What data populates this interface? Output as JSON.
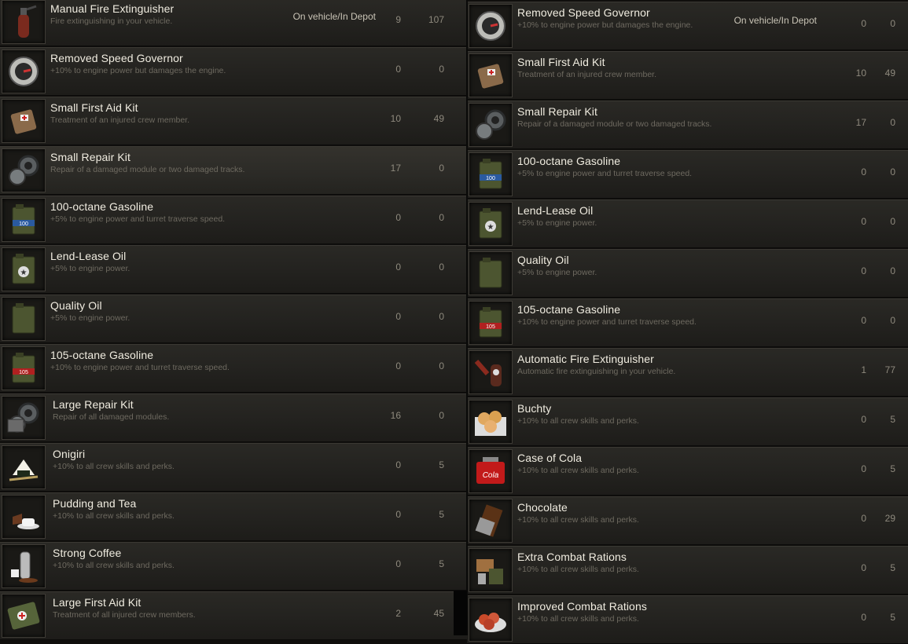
{
  "status_label": "On vehicle/In Depot",
  "left_items": [
    {
      "name": "Manual Fire Extinguisher",
      "desc": "Fire extinguishing in your vehicle.",
      "v1": "9",
      "v2": "107",
      "icon": "fire-extinguisher-icon",
      "status": true
    },
    {
      "name": "Removed Speed Governor",
      "desc": "+10% to engine power but damages the engine.",
      "v1": "0",
      "v2": "0",
      "icon": "speed-governor-icon"
    },
    {
      "name": "Small First Aid Kit",
      "desc": "Treatment of an injured crew member.",
      "v1": "10",
      "v2": "49",
      "icon": "first-aid-kit-icon"
    },
    {
      "name": "Small Repair Kit",
      "desc": "Repair of a damaged module or two damaged tracks.",
      "v1": "17",
      "v2": "0",
      "icon": "repair-kit-icon"
    },
    {
      "name": "100-octane Gasoline",
      "desc": "+5% to engine power and turret traverse speed.",
      "v1": "0",
      "v2": "0",
      "icon": "gasoline-100-icon"
    },
    {
      "name": "Lend-Lease Oil",
      "desc": "+5% to engine power.",
      "v1": "0",
      "v2": "0",
      "icon": "lend-lease-oil-icon"
    },
    {
      "name": "Quality Oil",
      "desc": "+5% to engine power.",
      "v1": "0",
      "v2": "0",
      "icon": "quality-oil-icon"
    },
    {
      "name": "105-octane Gasoline",
      "desc": "+10% to engine power and turret traverse speed.",
      "v1": "0",
      "v2": "0",
      "icon": "gasoline-105-icon"
    },
    {
      "name": "Large Repair Kit",
      "desc": "Repair of all damaged modules.",
      "v1": "16",
      "v2": "0",
      "icon": "large-repair-kit-icon"
    },
    {
      "name": "Onigiri",
      "desc": "+10% to all crew skills and perks.",
      "v1": "0",
      "v2": "5",
      "icon": "onigiri-icon"
    },
    {
      "name": "Pudding and Tea",
      "desc": "+10% to all crew skills and perks.",
      "v1": "0",
      "v2": "5",
      "icon": "pudding-tea-icon"
    },
    {
      "name": "Strong Coffee",
      "desc": "+10% to all crew skills and perks.",
      "v1": "0",
      "v2": "5",
      "icon": "coffee-icon"
    },
    {
      "name": "Large First Aid Kit",
      "desc": "Treatment of all injured crew members.",
      "v1": "2",
      "v2": "45",
      "icon": "large-first-aid-kit-icon"
    }
  ],
  "right_items": [
    {
      "name": "Removed Speed Governor",
      "desc": "+10% to engine power but damages the engine.",
      "v1": "0",
      "v2": "0",
      "icon": "speed-governor-icon",
      "status": true
    },
    {
      "name": "Small First Aid Kit",
      "desc": "Treatment of an injured crew member.",
      "v1": "10",
      "v2": "49",
      "icon": "first-aid-kit-icon"
    },
    {
      "name": "Small Repair Kit",
      "desc": "Repair of a damaged module or two damaged tracks.",
      "v1": "17",
      "v2": "0",
      "icon": "repair-kit-icon"
    },
    {
      "name": "100-octane Gasoline",
      "desc": "+5% to engine power and turret traverse speed.",
      "v1": "0",
      "v2": "0",
      "icon": "gasoline-100-icon"
    },
    {
      "name": "Lend-Lease Oil",
      "desc": "+5% to engine power.",
      "v1": "0",
      "v2": "0",
      "icon": "lend-lease-oil-icon"
    },
    {
      "name": "Quality Oil",
      "desc": "+5% to engine power.",
      "v1": "0",
      "v2": "0",
      "icon": "quality-oil-icon"
    },
    {
      "name": "105-octane Gasoline",
      "desc": "+10% to engine power and turret traverse speed.",
      "v1": "0",
      "v2": "0",
      "icon": "gasoline-105-icon"
    },
    {
      "name": "Automatic Fire Extinguisher",
      "desc": "Automatic fire extinguishing in your vehicle.",
      "v1": "1",
      "v2": "77",
      "icon": "auto-fire-extinguisher-icon"
    },
    {
      "name": "Buchty",
      "desc": "+10% to all crew skills and perks.",
      "v1": "0",
      "v2": "5",
      "icon": "buchty-icon"
    },
    {
      "name": "Case of Cola",
      "desc": "+10% to all crew skills and perks.",
      "v1": "0",
      "v2": "5",
      "icon": "cola-case-icon"
    },
    {
      "name": "Chocolate",
      "desc": "+10% to all crew skills and perks.",
      "v1": "0",
      "v2": "29",
      "icon": "chocolate-icon"
    },
    {
      "name": "Extra Combat Rations",
      "desc": "+10% to all crew skills and perks.",
      "v1": "0",
      "v2": "5",
      "icon": "combat-rations-icon"
    },
    {
      "name": "Improved Combat Rations",
      "desc": "+10% to all crew skills and perks.",
      "v1": "0",
      "v2": "5",
      "icon": "improved-rations-icon"
    }
  ]
}
